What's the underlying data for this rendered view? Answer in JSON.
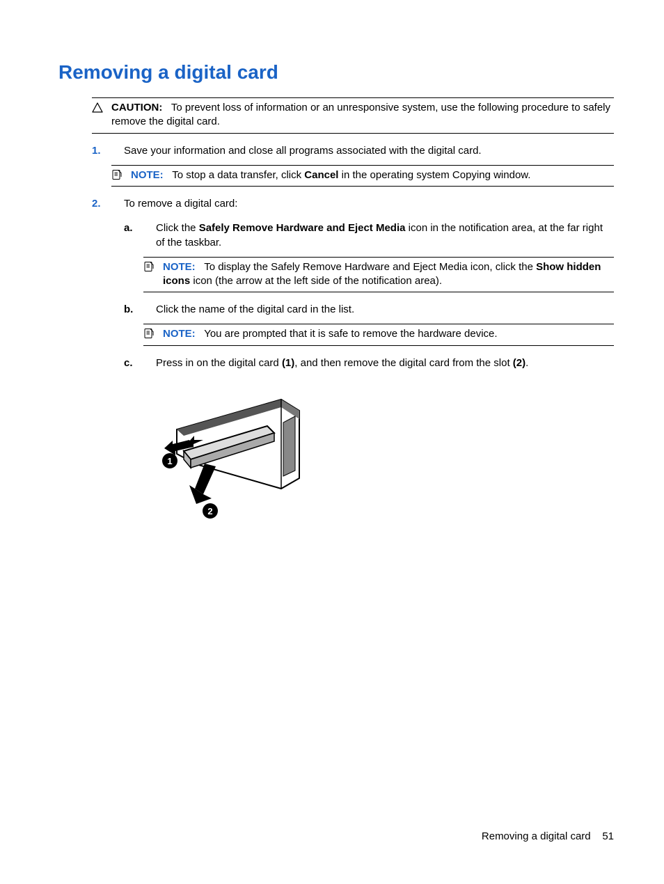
{
  "title": "Removing a digital card",
  "caution": {
    "label": "CAUTION:",
    "text": "To prevent loss of information or an unresponsive system, use the following procedure to safely remove the digital card."
  },
  "steps": [
    {
      "text": "Save your information and close all programs associated with the digital card.",
      "note": {
        "label": "NOTE:",
        "before": "To stop a data transfer, click ",
        "bold1": "Cancel",
        "after": " in the operating system Copying window."
      }
    },
    {
      "text": "To remove a digital card:",
      "substeps": [
        {
          "before": "Click the ",
          "bold1": "Safely Remove Hardware and Eject Media",
          "after": " icon in the notification area, at the far right of the taskbar.",
          "note": {
            "label": "NOTE:",
            "before": "To display the Safely Remove Hardware and Eject Media icon, click the ",
            "bold1": "Show hidden icons",
            "after": " icon (the arrow at the left side of the notification area)."
          }
        },
        {
          "text": "Click the name of the digital card in the list.",
          "note": {
            "label": "NOTE:",
            "text": "You are prompted that it is safe to remove the hardware device."
          }
        },
        {
          "before": "Press in on the digital card ",
          "bold1": "(1)",
          "mid": ", and then remove the digital card from the slot ",
          "bold2": "(2)",
          "after": "."
        }
      ]
    }
  ],
  "footer": {
    "text": "Removing a digital card",
    "page": "51"
  },
  "callouts": {
    "one": "1",
    "two": "2"
  }
}
